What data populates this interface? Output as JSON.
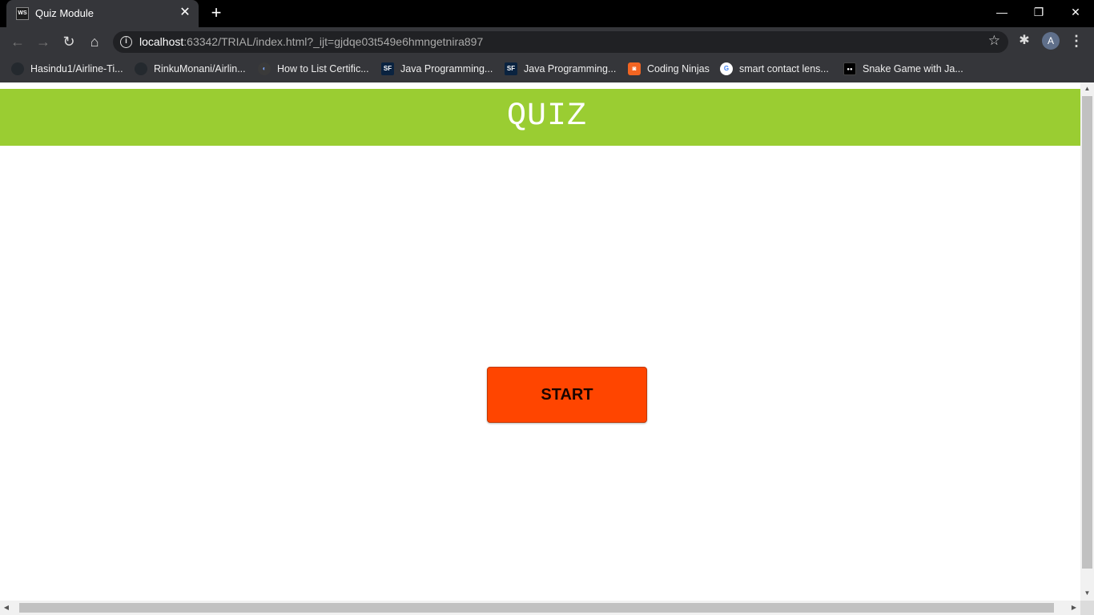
{
  "browser": {
    "tab": {
      "favicon_text": "WS",
      "title": "Quiz Module",
      "close": "✕"
    },
    "new_tab": "+",
    "window_controls": {
      "minimize": "—",
      "restore": "❐",
      "close": "✕"
    },
    "nav": {
      "back": "←",
      "forward": "→",
      "reload": "↻",
      "home": "⌂"
    },
    "url": {
      "host": "localhost",
      "rest": ":63342/TRIAL/index.html?_ijt=gjdqe03t549e6hmngetnira897"
    },
    "profile_initial": "A"
  },
  "bookmarks": [
    {
      "label": "Hasindu1/Airline-Ti...",
      "icon": "github-icon",
      "icon_text": "",
      "color": "#24292e"
    },
    {
      "label": "RinkuMonani/Airlin...",
      "icon": "github-icon",
      "icon_text": "",
      "color": "#24292e"
    },
    {
      "label": "How to List Certific...",
      "icon": "loading-icon",
      "icon_text": "◐",
      "color": "#3a3a3a"
    },
    {
      "label": "Java Programming...",
      "icon": "sf-icon",
      "icon_text": "SF",
      "color": "#0a2340"
    },
    {
      "label": "Java Programming...",
      "icon": "sf-icon",
      "icon_text": "SF",
      "color": "#0a2340"
    },
    {
      "label": "Coding Ninjas",
      "icon": "coding-ninjas-icon",
      "icon_text": "◙",
      "color": "#f26522"
    },
    {
      "label": "smart contact lens...",
      "icon": "google-icon",
      "icon_text": "G",
      "color": "#ffffff"
    },
    {
      "label": "Snake Game with Ja...",
      "icon": "medium-icon",
      "icon_text": "●●",
      "color": "#000000"
    }
  ],
  "page": {
    "header_title": "QUIZ",
    "start_label": "START"
  },
  "colors": {
    "header_bg": "#9acd32",
    "start_bg": "#ff4500"
  }
}
